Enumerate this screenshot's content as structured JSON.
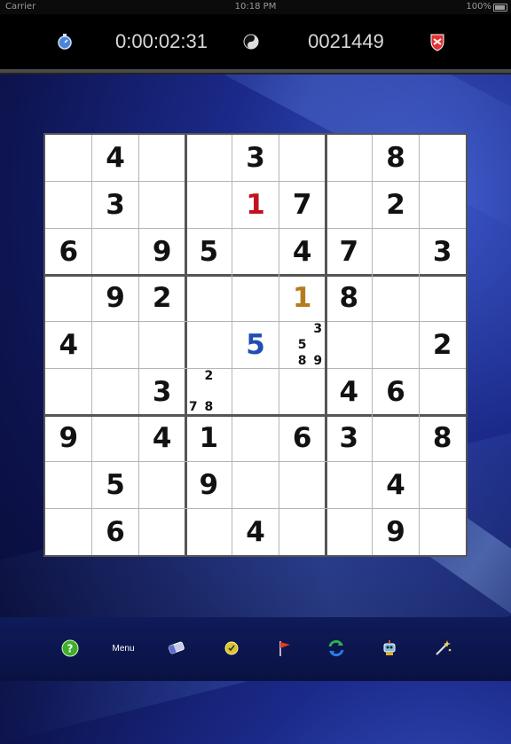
{
  "status_bar": {
    "carrier": "Carrier",
    "time": "10:18 PM",
    "battery": "100%"
  },
  "header": {
    "timer": "0:00:02:31",
    "score": "0021449"
  },
  "board": {
    "givens": [
      [
        null,
        4,
        null,
        null,
        3,
        null,
        null,
        8,
        null
      ],
      [
        null,
        3,
        null,
        null,
        1,
        7,
        null,
        2,
        null
      ],
      [
        6,
        null,
        9,
        5,
        null,
        4,
        7,
        null,
        3
      ],
      [
        null,
        9,
        2,
        null,
        null,
        1,
        8,
        null,
        null
      ],
      [
        4,
        null,
        null,
        null,
        5,
        null,
        null,
        null,
        2
      ],
      [
        null,
        null,
        3,
        null,
        null,
        null,
        4,
        6,
        null
      ],
      [
        9,
        null,
        4,
        1,
        null,
        6,
        3,
        null,
        8
      ],
      [
        null,
        5,
        null,
        9,
        null,
        null,
        null,
        4,
        null
      ],
      [
        null,
        6,
        null,
        null,
        4,
        null,
        null,
        9,
        null
      ]
    ],
    "colored_cells": [
      {
        "row": 1,
        "col": 4,
        "color": "#c1121f"
      },
      {
        "row": 3,
        "col": 5,
        "color": "#b47a1f"
      },
      {
        "row": 4,
        "col": 4,
        "color": "#1f4fb4"
      }
    ],
    "notes": [
      {
        "row": 4,
        "col": 5,
        "digits": [
          3,
          5,
          8,
          9
        ]
      },
      {
        "row": 5,
        "col": 3,
        "digits": [
          2,
          7,
          8
        ]
      }
    ]
  },
  "toolbar": {
    "menu_label": "Menu",
    "icons": [
      "help-icon",
      "menu",
      "eraser-icon",
      "hint-icon",
      "flag-icon",
      "refresh-icon",
      "robot-icon",
      "magic-wand-icon"
    ]
  },
  "colors": {
    "background": "#0d1450",
    "header": "#000000",
    "red": "#c1121f",
    "gold": "#b47a1f",
    "blue": "#1f4fb4"
  }
}
